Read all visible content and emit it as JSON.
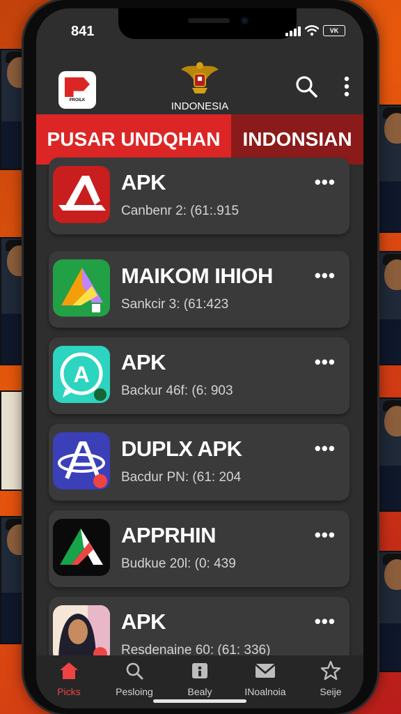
{
  "status_bar": {
    "time": "841",
    "battery": "VK"
  },
  "header": {
    "app_logo_text": "PROILK",
    "country_label": "INDONESIA",
    "search_icon": "search-icon",
    "more_icon": "more-vertical-icon"
  },
  "banner": {
    "tabs": [
      {
        "label": "PUSAR UNDQHAN"
      },
      {
        "label": "INDONSIAN"
      }
    ]
  },
  "apps": [
    {
      "title": "APK",
      "subtitle": "Canbenr 2: (61:.915",
      "icon": "red-a-icon"
    },
    {
      "title": "MAIKOM IHIOH",
      "subtitle": "Sankcir 3: (61:423",
      "icon": "green-triangle-icon"
    },
    {
      "title": "APK",
      "subtitle": "Backur 46f: (6: 903",
      "icon": "teal-chat-a-icon"
    },
    {
      "title": "DUPLX APK",
      "subtitle": "Bacdur PN: (61: 204",
      "icon": "blue-orbit-a-icon"
    },
    {
      "title": "APPRHIN",
      "subtitle": "Budkue 20l: (0: 439",
      "icon": "black-triangle-icon"
    },
    {
      "title": "APK",
      "subtitle": "Resdenaine 60: (61: 336)",
      "icon": "woman-portrait-icon"
    }
  ],
  "bottom_nav": [
    {
      "label": "Picks",
      "icon": "home-icon",
      "active": true
    },
    {
      "label": "Pesloing",
      "icon": "search-icon",
      "active": false
    },
    {
      "label": "Bealy",
      "icon": "info-box-icon",
      "active": false
    },
    {
      "label": "INoalnoia",
      "icon": "mail-icon",
      "active": false
    },
    {
      "label": "Seije",
      "icon": "star-icon",
      "active": false
    }
  ],
  "colors": {
    "accent_red": "#dc2626",
    "dark_red": "#8b1a1a",
    "screen_bg": "#2e2e2e",
    "card_bg": "#3a3a3a"
  }
}
